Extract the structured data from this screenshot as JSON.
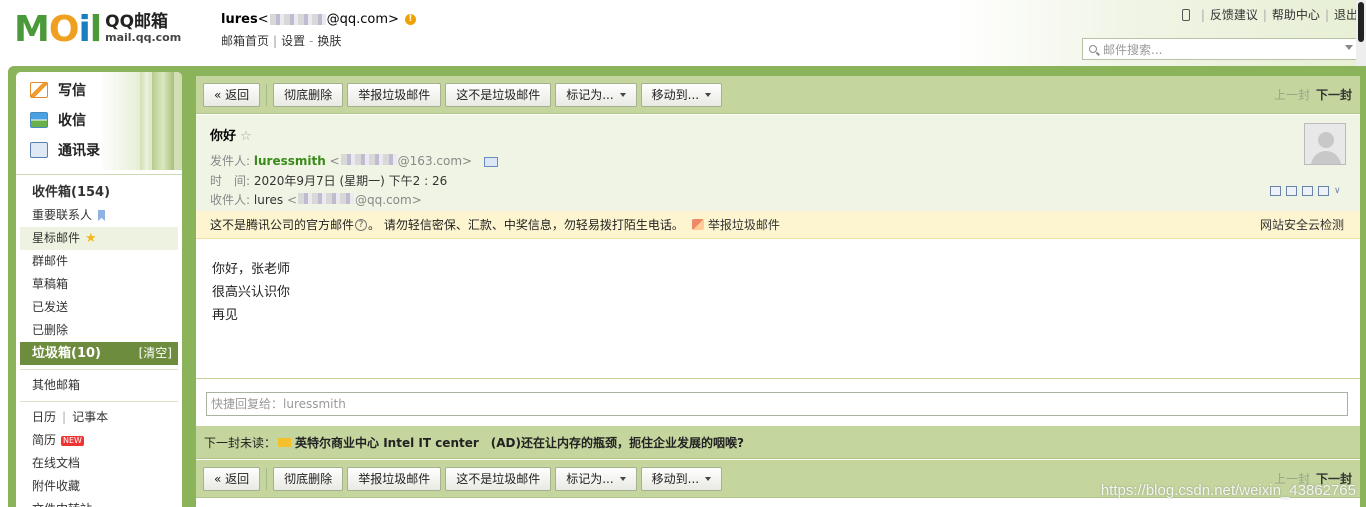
{
  "header": {
    "logo_text": "MOil",
    "brand_title": "QQ邮箱",
    "brand_domain": "mail.qq.com",
    "account_name": "lures",
    "account_email_open": "<",
    "account_email_suffix": "@qq.com>",
    "nav_home": "邮箱首页",
    "nav_settings": "设置",
    "nav_skin": "换肤",
    "nav_sep": "|",
    "feedback": "反馈建议",
    "help": "帮助中心",
    "logout": "退出",
    "top_sep": "|",
    "search_placeholder": "邮件搜索..."
  },
  "quick_actions": {
    "compose": "写信",
    "receive": "收信",
    "contacts": "通讯录"
  },
  "folders": {
    "inbox": "收件箱(154)",
    "important": "重要联系人",
    "starred": "星标邮件",
    "group": "群邮件",
    "drafts": "草稿箱",
    "sent": "已发送",
    "deleted": "已删除",
    "spam": "垃圾箱(10)",
    "spam_clear": "[清空]",
    "other": "其他邮箱",
    "calendar": "日历",
    "notebook": "记事本",
    "resume": "简历",
    "resume_badge": "NEW",
    "docs": "在线文档",
    "attachments": "附件收藏",
    "transfer": "文件中转站"
  },
  "toolbar": {
    "back": "« 返回",
    "delete_permanent": "彻底删除",
    "report_spam": "举报垃圾邮件",
    "not_spam": "这不是垃圾邮件",
    "mark_as": "标记为...",
    "move_to": "移动到...",
    "prev": "上一封",
    "next": "下一封"
  },
  "mail": {
    "subject": "你好",
    "from_label": "发件人:",
    "from_name": "luressmith",
    "from_email_open": "<",
    "from_email_suffix": "@163.com>",
    "time_label": "时　间:",
    "time_value": "2020年9月7日 (星期一) 下午2 : 26",
    "to_label": "收件人:",
    "to_name": "lures",
    "to_email_open": "<",
    "to_email_suffix": "@qq.com>",
    "body_lines": [
      "你好，张老师",
      "很高兴认识你",
      "再见"
    ]
  },
  "notice": {
    "text_a": "这不是腾讯公司的官方邮件",
    "text_b": "。  请勿轻信密保、汇款、中奖信息，勿轻易拨打陌生电话。",
    "report": "举报垃圾邮件",
    "security": "网站安全云检测"
  },
  "reply": {
    "placeholder": "快捷回复给：luressmith"
  },
  "next_unread": {
    "label": "下一封未读：",
    "subject": "英特尔商业中心 Intel IT center　(AD)还在让内存的瓶颈，扼住企业发展的咽喉?"
  },
  "watermark": "https://blog.csdn.net/weixin_43862765"
}
